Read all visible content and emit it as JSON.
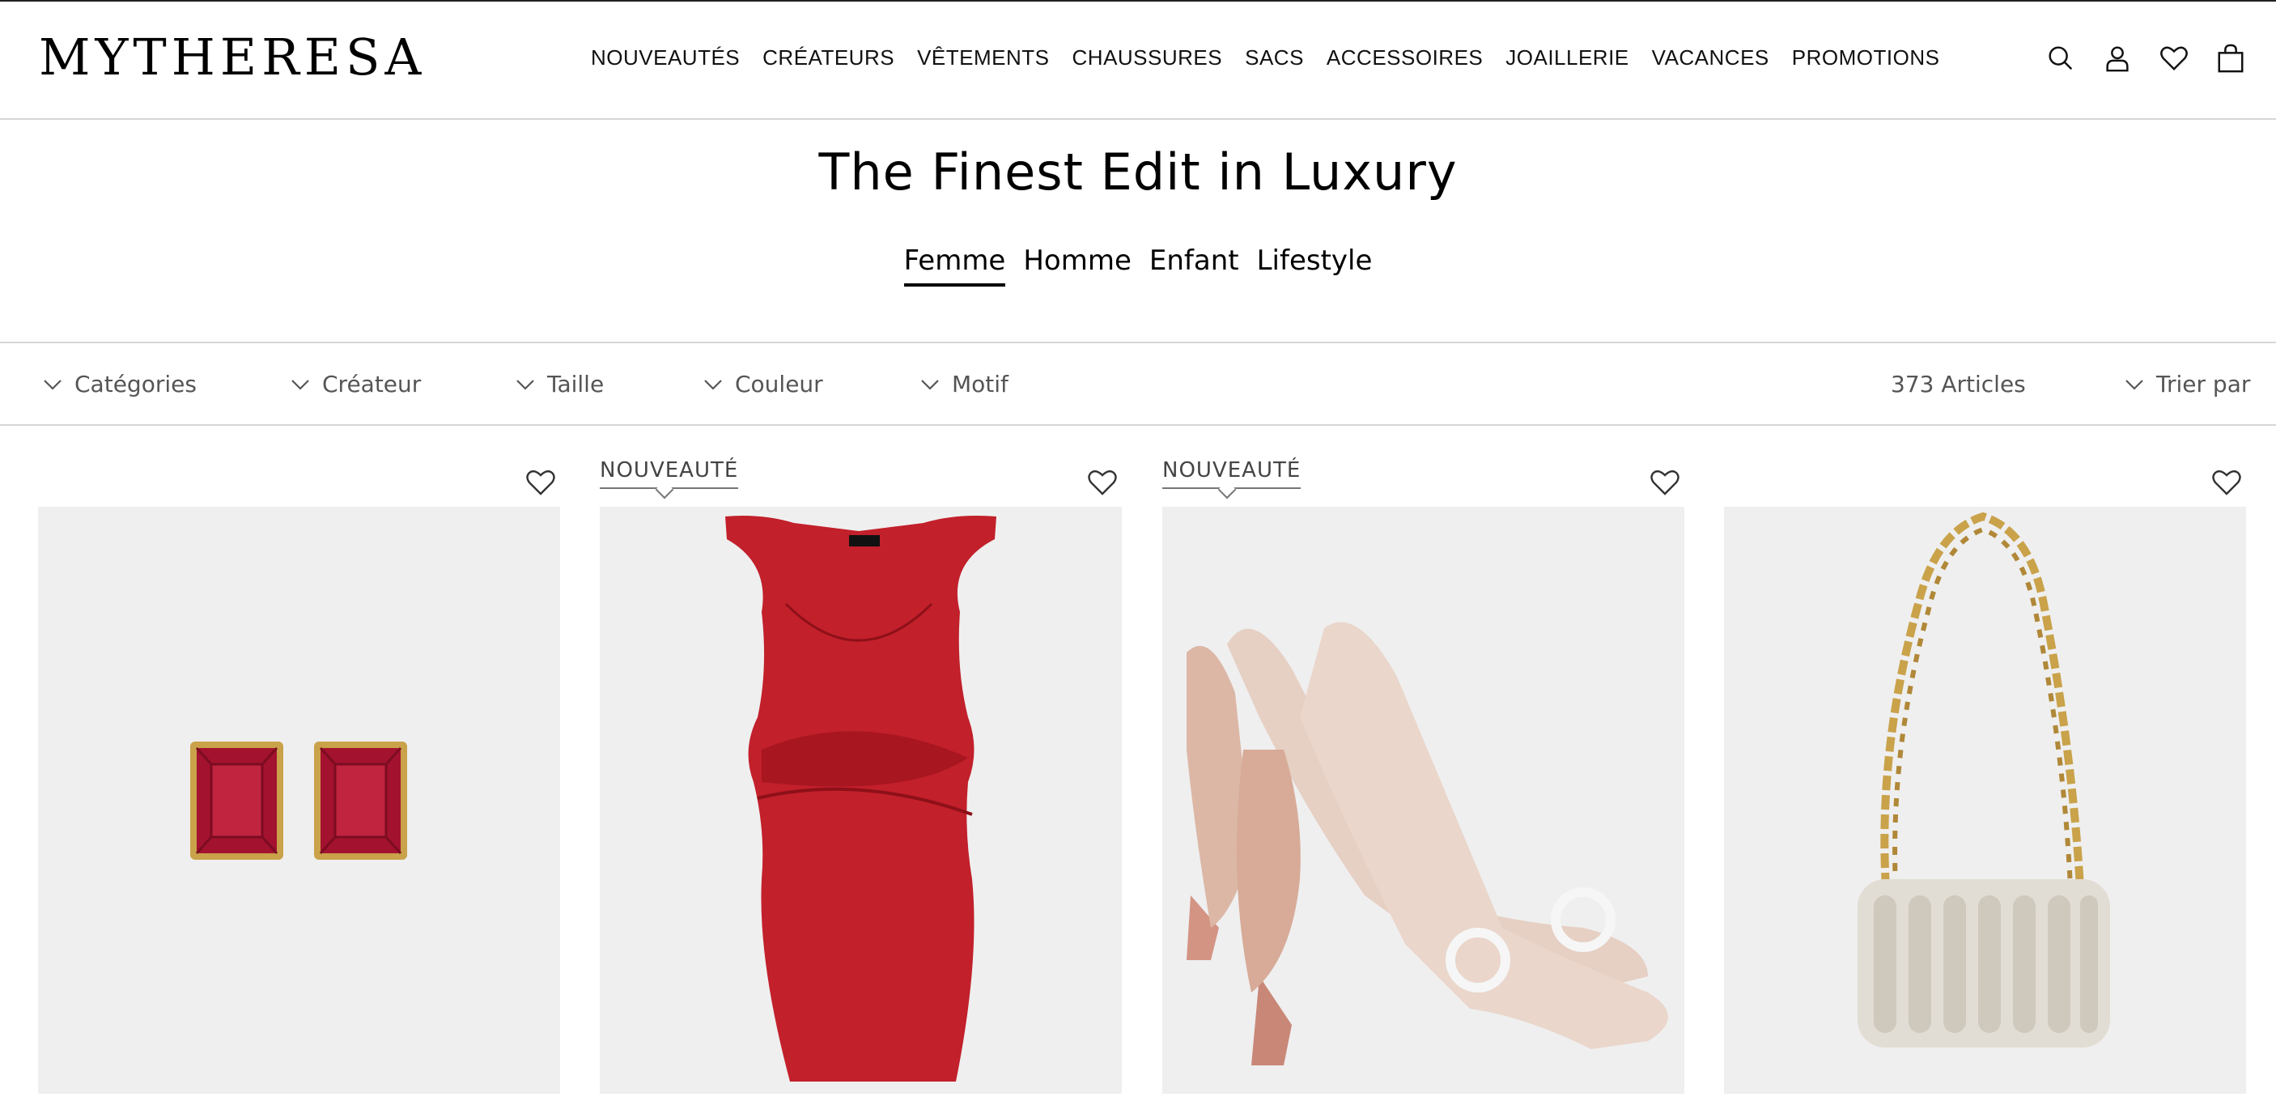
{
  "brand": {
    "logo": "MYTHERESA"
  },
  "nav": {
    "items": [
      "NOUVEAUTÉS",
      "CRÉATEURS",
      "VÊTEMENTS",
      "CHAUSSURES",
      "SACS",
      "ACCESSOIRES",
      "JOAILLERIE",
      "VACANCES",
      "PROMOTIONS"
    ]
  },
  "header_icons": [
    "search-icon",
    "account-icon",
    "wishlist-icon",
    "bag-icon"
  ],
  "hero": {
    "title": "The Finest Edit in Luxury",
    "tabs": [
      {
        "label": "Femme",
        "active": true
      },
      {
        "label": "Homme",
        "active": false
      },
      {
        "label": "Enfant",
        "active": false
      },
      {
        "label": "Lifestyle",
        "active": false
      }
    ]
  },
  "filters": {
    "items": [
      "Catégories",
      "Créateur",
      "Taille",
      "Couleur",
      "Motif"
    ],
    "count": "373 Articles",
    "sort": "Trier par"
  },
  "products": [
    {
      "badge": "",
      "image": "ruby-earrings"
    },
    {
      "badge": "NOUVEAUTÉ",
      "image": "red-leather-dress"
    },
    {
      "badge": "NOUVEAUTÉ",
      "image": "velvet-slingback-pumps"
    },
    {
      "badge": "",
      "image": "shearling-chain-bag"
    }
  ],
  "colors": {
    "image_bg": "#efefef",
    "divider": "#d6d6d6",
    "ruby": "#a3122e",
    "dress_red": "#c2202b",
    "velvet": "#e6cfc3",
    "gold": "#c9a24a"
  }
}
